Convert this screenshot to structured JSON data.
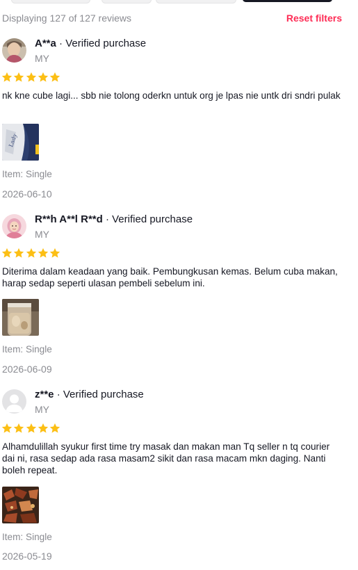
{
  "header": {
    "count_text": "Displaying 127 of 127 reviews",
    "reset_label": "Reset filters"
  },
  "colors": {
    "accent": "#fe2c55",
    "star": "#fcbf15",
    "muted": "#8a8b91"
  },
  "reviews": [
    {
      "name": "A**a",
      "verified": " · Verified purchase",
      "country": "MY",
      "rating": 5,
      "text": "nk kne cube lagi... sbb nie tolong oderkn untuk org je lpas nie untk dri sndri pulak",
      "item_label": "Item: ",
      "item_value": "Single",
      "date": "2026-06-10",
      "avatar_icon": "profile-photo",
      "photo_icon": "product-photo"
    },
    {
      "name": "R**h A**l R**d",
      "verified": " · Verified purchase",
      "country": "MY",
      "rating": 5,
      "text": "Diterima dalam keadaan yang baik. Pembungkusan kemas. Belum cuba makan, harap sedap seperti ulasan pembeli sebelum ini.",
      "item_label": "Item: ",
      "item_value": "Single",
      "date": "2026-06-09",
      "avatar_icon": "profile-photo",
      "photo_icon": "product-photo"
    },
    {
      "name": "z**e",
      "verified": " · Verified purchase",
      "country": "MY",
      "rating": 5,
      "text": "Alhamdulillah syukur first time try masak dan makan man Tq seller n tq courier dai ni, rasa sedap ada rasa masam2 sikit dan rasa macam mkn daging. Nanti boleh repeat.",
      "item_label": "Item: ",
      "item_value": "Single",
      "date": "2026-05-19",
      "avatar_icon": "default-avatar",
      "photo_icon": "product-photo"
    }
  ]
}
